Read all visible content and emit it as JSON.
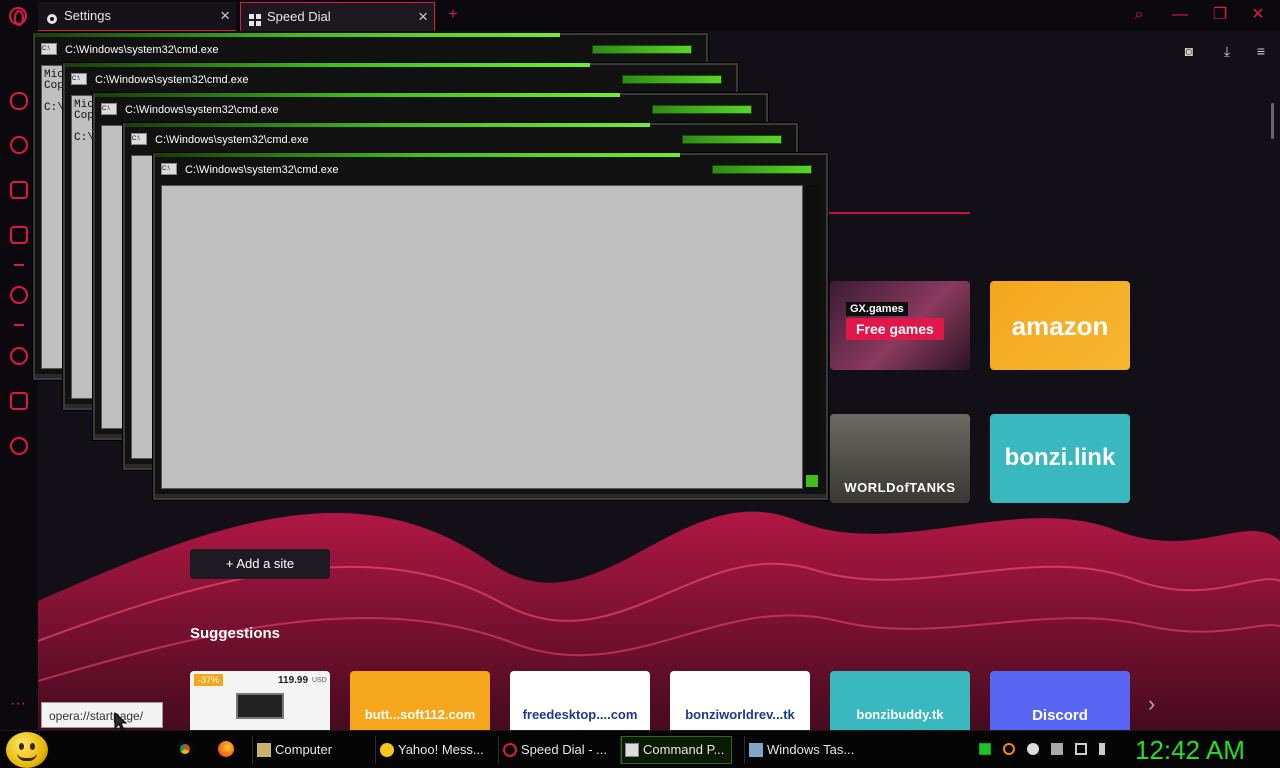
{
  "browser": {
    "tabs": [
      {
        "label": "Settings",
        "icon": "gear-icon"
      },
      {
        "label": "Speed Dial",
        "icon": "grid-icon"
      }
    ],
    "new_tab_symbol": "+",
    "window_controls": {
      "search": "⌕",
      "minimize": "—",
      "restore": "❐",
      "close": "✕"
    }
  },
  "sidebar": {
    "items": [
      "gamepad-icon",
      "gx-control-icon",
      "bag-icon",
      "twitch-icon",
      "player-icon",
      "history-icon",
      "cube-icon",
      "settings-icon"
    ],
    "more": "···"
  },
  "speed_dial": {
    "tiles": [
      {
        "brand": "GX.games",
        "label": "Free games"
      },
      {
        "label": "amazon"
      },
      {
        "label": "WORLDofTANKS"
      },
      {
        "label": "bonzi.link"
      }
    ],
    "add_site": "+ Add a site",
    "suggestions_title": "Suggestions",
    "suggestions": [
      {
        "badge": "-37%",
        "price": "119.99",
        "currency": "USD"
      },
      {
        "label": "butt...soft112.com"
      },
      {
        "label": "freedesktop....com"
      },
      {
        "label": "bonziworldrev...tk"
      },
      {
        "label": "bonzibuddy.tk"
      },
      {
        "label": "Discord"
      }
    ]
  },
  "status_url": "opera://startpage/",
  "cmd_windows": [
    {
      "title": "C:\\Windows\\system32\\cmd.exe",
      "text": "Mic\nCop\n\nC:\\"
    },
    {
      "title": "C:\\Windows\\system32\\cmd.exe",
      "text": "Mic\nCop\n\nC:\\"
    },
    {
      "title": "C:\\Windows\\system32\\cmd.exe",
      "text": ""
    },
    {
      "title": "C:\\Windows\\system32\\cmd.exe",
      "text": ""
    },
    {
      "title": "C:\\Windows\\system32\\cmd.exe",
      "text": ""
    }
  ],
  "taskbar": {
    "items": [
      "Computer",
      "Yahoo! Mess...",
      "Speed Dial - ...",
      "Command P...",
      "Windows Tas..."
    ],
    "clock": "12:42 AM"
  },
  "colors": {
    "accent": "#e0184a",
    "cmd_green": "#3fbf17",
    "clock": "#22e02a"
  }
}
